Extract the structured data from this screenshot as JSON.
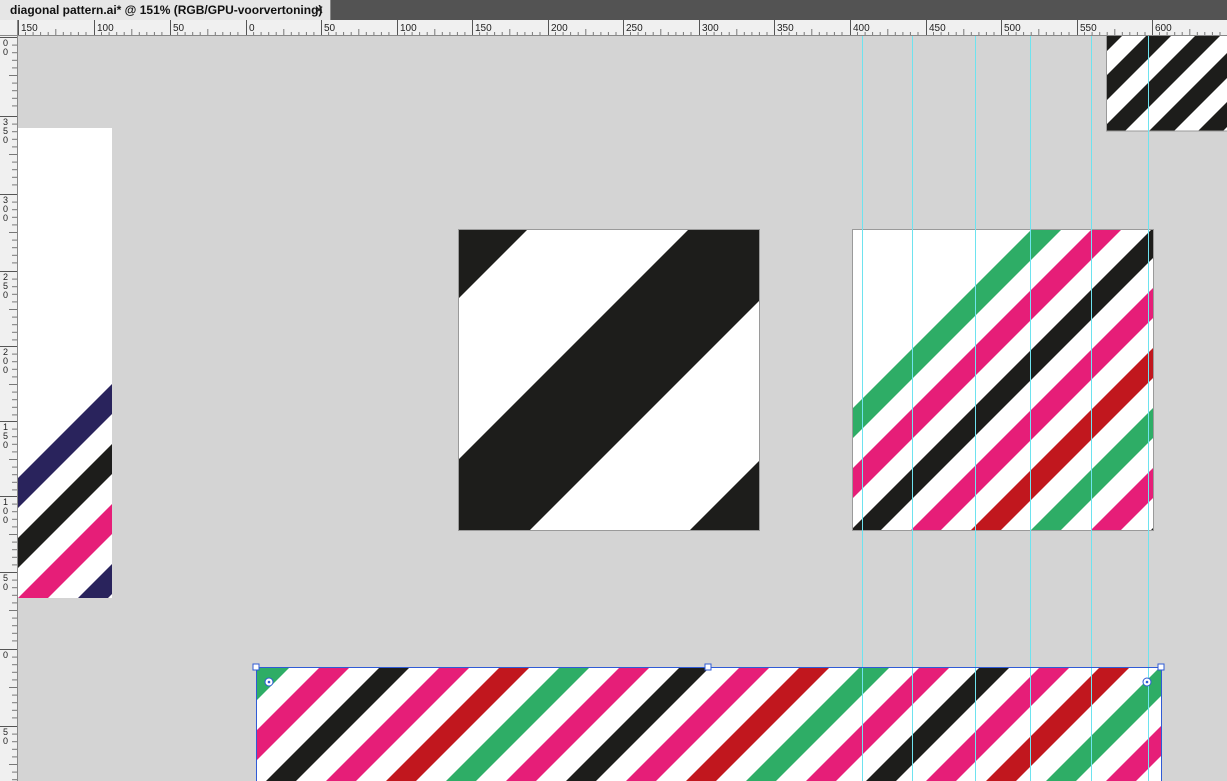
{
  "document": {
    "tab_title": "diagonal pattern.ai* @ 151% (RGB/GPU-voorvertoning)",
    "close_glyph": "✕"
  },
  "rulers": {
    "horizontal_labels": [
      "150",
      "100",
      "50",
      "0",
      "50",
      "100",
      "150",
      "200",
      "250",
      "300",
      "350",
      "400",
      "450",
      "500",
      "550",
      "600"
    ],
    "vertical_labels": [
      [
        "0",
        "0"
      ],
      [
        "3",
        "5",
        "0"
      ],
      [
        "3",
        "0",
        "0"
      ],
      [
        "2",
        "5",
        "0"
      ],
      [
        "2",
        "0",
        "0"
      ],
      [
        "1",
        "5",
        "0"
      ],
      [
        "1",
        "0",
        "0"
      ],
      [
        "5",
        "0"
      ],
      [
        "0"
      ],
      [
        "5",
        "0"
      ]
    ]
  },
  "colors": {
    "canvas": "#d4d4d4",
    "black": "#1d1d1b",
    "white": "#ffffff",
    "pink": "#e61e78",
    "navy": "#29235c",
    "red": "#c1171e",
    "green": "#2ead66",
    "guide": "#6ee3ef",
    "selection": "#2f5bd6"
  },
  "swatches": {
    "pink_navy_black": [
      "#1d1d1b",
      "#e61e78",
      "#29235c",
      "#29235c",
      "#e61e78",
      "#1d1d1b",
      "#e61e78",
      "#29235c",
      "#29235c"
    ],
    "multicolor": [
      "#e61e78",
      "#c1171e",
      "#2ead66",
      "#e61e78",
      "#1d1d1b"
    ]
  }
}
